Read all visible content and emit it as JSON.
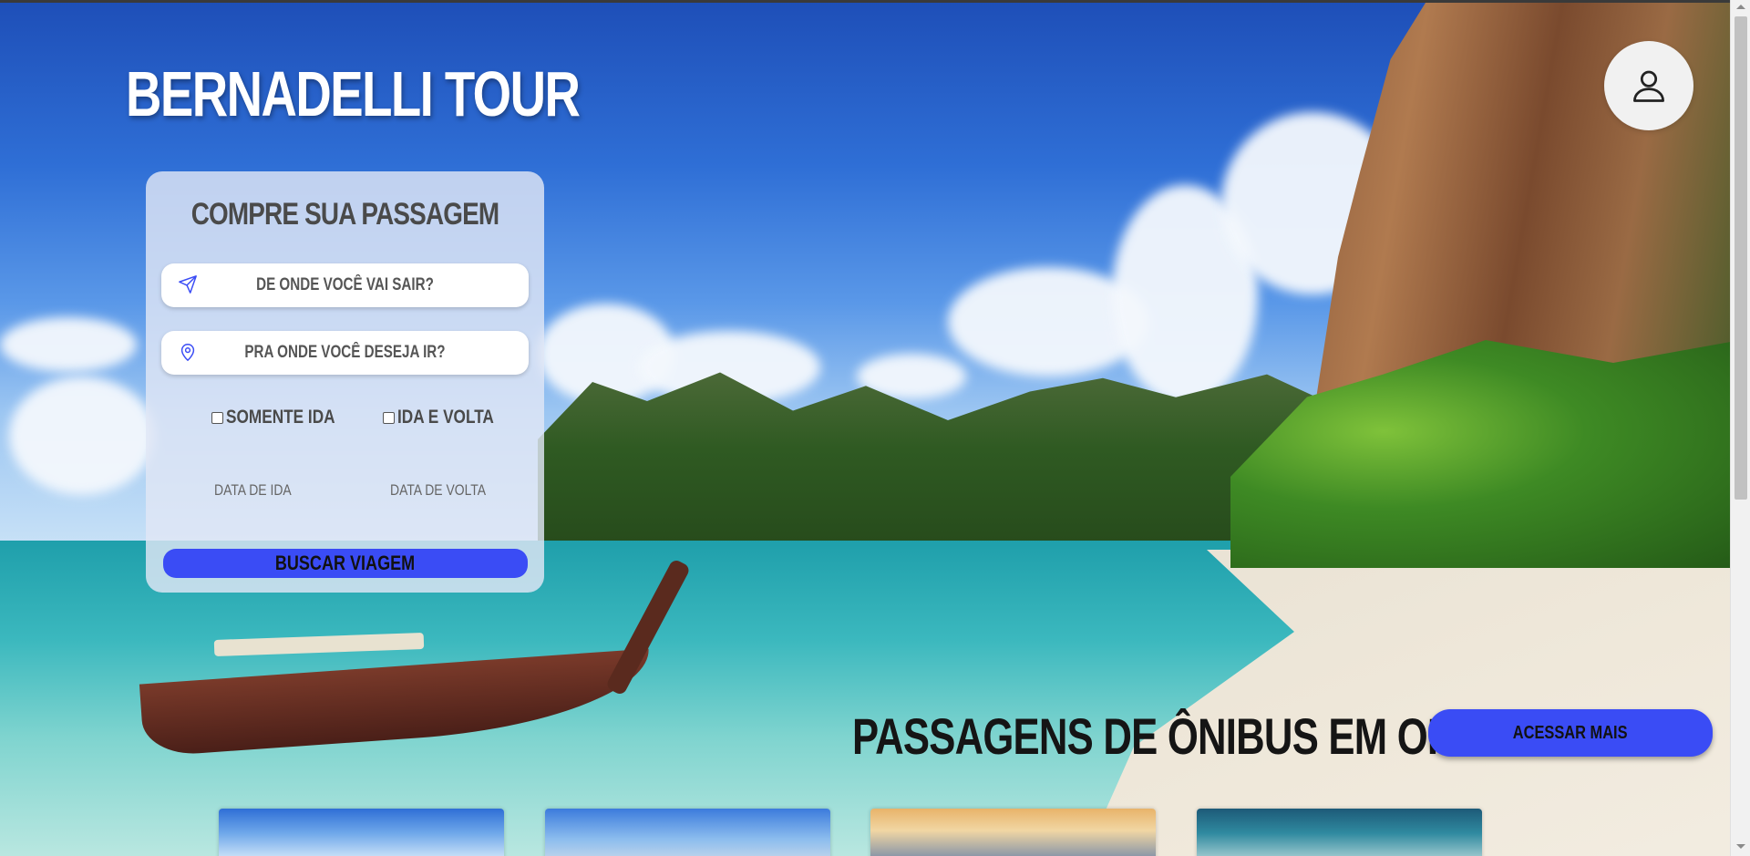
{
  "brand": {
    "title": "BERNADELLI TOUR"
  },
  "header": {
    "profile_icon": "user-icon"
  },
  "booking": {
    "title": "COMPRE SUA PASSAGEM",
    "origin": {
      "placeholder": "DE ONDE VOCÊ VAI SAIR?",
      "icon": "send-icon"
    },
    "destination": {
      "placeholder": "PRA ONDE VOCÊ DESEJA IR?",
      "icon": "map-pin-icon"
    },
    "one_way_label": "SOMENTE IDA",
    "round_trip_label": "IDA E VOLTA",
    "one_way_checked": false,
    "round_trip_checked": false,
    "departure_date_label": "DATA DE IDA",
    "return_date_label": "DATA DE VOLTA",
    "search_button": "BUSCAR VIAGEM"
  },
  "offers": {
    "title": "PASSAGENS DE ÔNIBUS EM OFERTA",
    "more_button": "ACESSAR MAIS"
  },
  "colors": {
    "accent": "#3a4cf5",
    "card_bg": "#e1e6f5",
    "title_text": "#4a4a4a"
  }
}
